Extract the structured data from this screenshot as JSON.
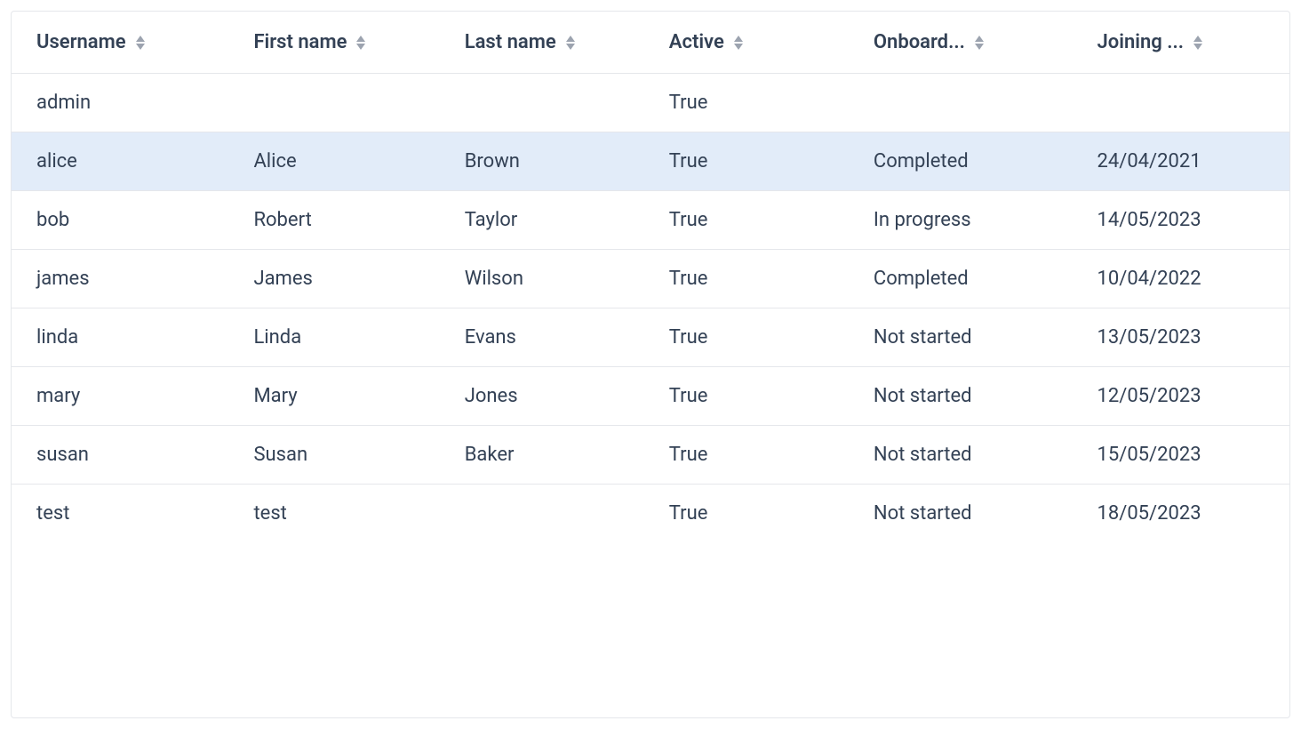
{
  "table": {
    "columns": [
      {
        "key": "username",
        "label": "Username"
      },
      {
        "key": "firstname",
        "label": "First name"
      },
      {
        "key": "lastname",
        "label": "Last name"
      },
      {
        "key": "active",
        "label": "Active"
      },
      {
        "key": "onboard",
        "label": "Onboard..."
      },
      {
        "key": "joining",
        "label": "Joining ..."
      }
    ],
    "rows": [
      {
        "username": "admin",
        "firstname": "",
        "lastname": "",
        "active": "True",
        "onboard": "",
        "joining": "",
        "highlighted": false
      },
      {
        "username": "alice",
        "firstname": "Alice",
        "lastname": "Brown",
        "active": "True",
        "onboard": "Completed",
        "joining": "24/04/2021",
        "highlighted": true
      },
      {
        "username": "bob",
        "firstname": "Robert",
        "lastname": "Taylor",
        "active": "True",
        "onboard": "In progress",
        "joining": "14/05/2023",
        "highlighted": false
      },
      {
        "username": "james",
        "firstname": "James",
        "lastname": "Wilson",
        "active": "True",
        "onboard": "Completed",
        "joining": "10/04/2022",
        "highlighted": false
      },
      {
        "username": "linda",
        "firstname": "Linda",
        "lastname": "Evans",
        "active": "True",
        "onboard": "Not started",
        "joining": "13/05/2023",
        "highlighted": false
      },
      {
        "username": "mary",
        "firstname": "Mary",
        "lastname": "Jones",
        "active": "True",
        "onboard": "Not started",
        "joining": "12/05/2023",
        "highlighted": false
      },
      {
        "username": "susan",
        "firstname": "Susan",
        "lastname": "Baker",
        "active": "True",
        "onboard": "Not started",
        "joining": "15/05/2023",
        "highlighted": false
      },
      {
        "username": "test",
        "firstname": "test",
        "lastname": "",
        "active": "True",
        "onboard": "Not started",
        "joining": "18/05/2023",
        "highlighted": false
      }
    ]
  }
}
